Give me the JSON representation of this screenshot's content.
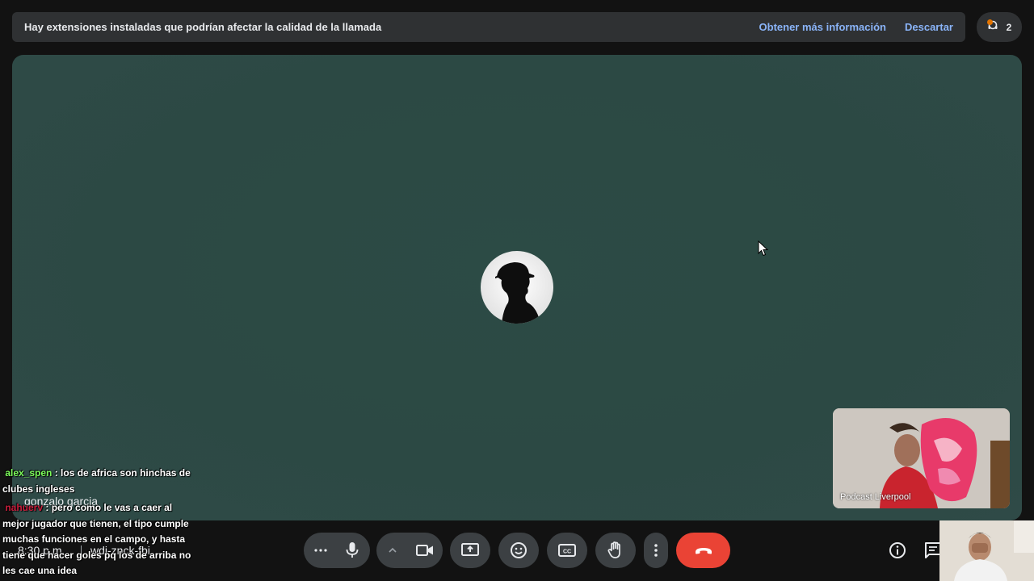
{
  "banner": {
    "message": "Hay extensiones instaladas que podrían afectar la calidad de la llamada",
    "learn_more": "Obtener más información",
    "dismiss": "Descartar"
  },
  "participants": {
    "count": "2",
    "icon": "people-icon"
  },
  "main_tile": {
    "name": "gonzalo garcia",
    "avatar_icon": "person-silhouette-avatar"
  },
  "pip_tile": {
    "name": "Podcast Liverpool"
  },
  "meeting": {
    "time": "8:30 p.m.",
    "code": "wdi-znck-fbi"
  },
  "chat_overlay": [
    {
      "user": "alex_spen",
      "text": " : los de africa son hinchas de clubes ingleses"
    },
    {
      "user": "nahuerv",
      "text": " : pero como le vas a caer al mejor jugador que tienen, el tipo cumple muchas funciones en el campo, y hasta tiene que hacer goles pq los de arriba no les cae una idea"
    }
  ],
  "toolbar": {
    "buttons": [
      "more-options-icon",
      "microphone-icon",
      "chevron-up-icon",
      "camera-icon",
      "present-screen-icon",
      "emoji-icon",
      "captions-icon",
      "raise-hand-icon",
      "more-vert-icon",
      "end-call-icon"
    ],
    "right_icons": [
      "info-icon",
      "chat-icon"
    ]
  },
  "colors": {
    "stage": "#2c4a45",
    "banner": "#2f3133",
    "link": "#8ab4f8",
    "end_call": "#ea4335",
    "button": "#3c4043"
  }
}
